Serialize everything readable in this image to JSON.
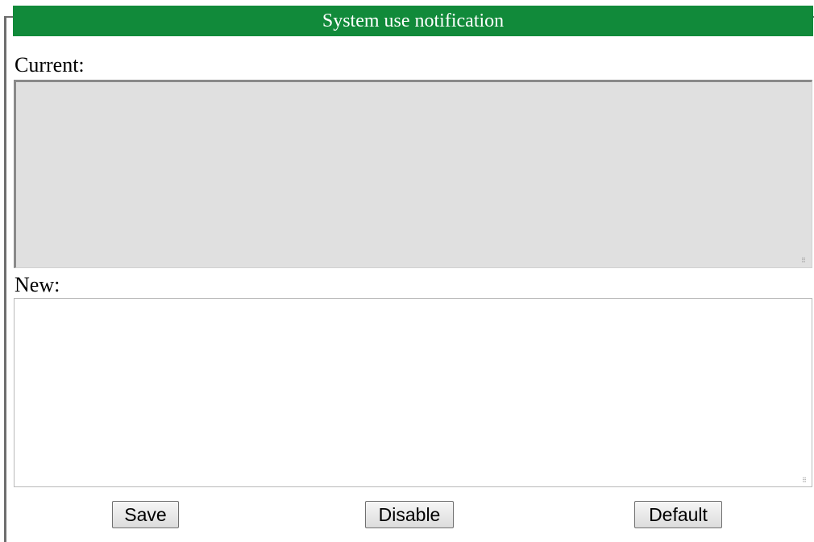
{
  "header": {
    "title": "System use notification",
    "color": "#118a3a"
  },
  "current": {
    "label": "Current:",
    "value": "",
    "background": "#e0e0e0",
    "disabled": true
  },
  "new": {
    "label": "New:",
    "value": ""
  },
  "actions": {
    "save_label": "Save",
    "disable_label": "Disable",
    "default_label": "Default"
  },
  "icons": {
    "resize_grip": "resize-grip-icon"
  }
}
